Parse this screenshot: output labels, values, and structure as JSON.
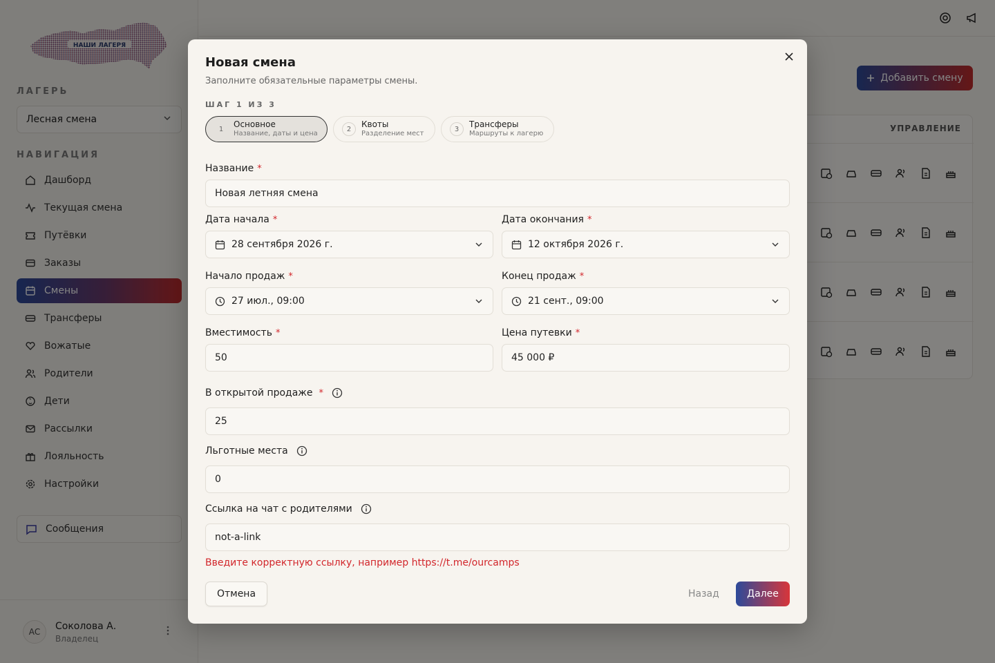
{
  "sidebar": {
    "logo_text": "НАШИ ЛАГЕРЯ",
    "camp_caption": "ЛАГЕРЬ",
    "camp_selected": "Лесная смена",
    "nav_caption": "НАВИГАЦИЯ",
    "items": [
      {
        "label": "Дашборд",
        "icon": "home-icon"
      },
      {
        "label": "Текущая смена",
        "icon": "activity-icon"
      },
      {
        "label": "Путёвки",
        "icon": "ticket-icon"
      },
      {
        "label": "Заказы",
        "icon": "card-icon"
      },
      {
        "label": "Смены",
        "icon": "calendar-icon",
        "active": true
      },
      {
        "label": "Трансферы",
        "icon": "bus-icon"
      },
      {
        "label": "Вожатые",
        "icon": "heart-hand-icon"
      },
      {
        "label": "Родители",
        "icon": "users-icon"
      },
      {
        "label": "Дети",
        "icon": "baby-icon"
      },
      {
        "label": "Рассылки",
        "icon": "mail-icon"
      },
      {
        "label": "Лояльность",
        "icon": "gift-icon"
      },
      {
        "label": "Настройки",
        "icon": "gear-icon"
      }
    ],
    "messages_label": "Сообщения",
    "user": {
      "initials": "АС",
      "name": "Соколова А.",
      "role": "Владелец"
    }
  },
  "main": {
    "add_button": "Добавить смену",
    "table_header": "УПРАВЛЕНИЕ"
  },
  "modal": {
    "title": "Новая смена",
    "subtitle": "Заполните обязательные параметры смены.",
    "step_indicator": "ШАГ 1 ИЗ 3",
    "steps": [
      {
        "num": "1",
        "title": "Основное",
        "desc": "Название, даты и цена"
      },
      {
        "num": "2",
        "title": "Квоты",
        "desc": "Разделение мест"
      },
      {
        "num": "3",
        "title": "Трансферы",
        "desc": "Маршруты к лагерю"
      }
    ],
    "fields": {
      "name": {
        "label": "Название",
        "value": "Новая летняя смена"
      },
      "start_date": {
        "label": "Дата начала",
        "value": "28 сентября 2026 г."
      },
      "end_date": {
        "label": "Дата окончания",
        "value": "12 октября 2026 г."
      },
      "sales_start": {
        "label": "Начало продаж",
        "value": "27 июл., 09:00"
      },
      "sales_end": {
        "label": "Конец продаж",
        "value": "21 сент., 09:00"
      },
      "capacity": {
        "label": "Вместимость",
        "value": "50"
      },
      "price": {
        "label": "Цена путевки",
        "value": "45 000 ₽"
      },
      "open_sale": {
        "label": "В открытой продаже",
        "value": "25"
      },
      "benefit": {
        "label": "Льготные места",
        "value": "0"
      },
      "chat_link": {
        "label": "Ссылка на чат с родителями",
        "value": "not-a-link"
      }
    },
    "required_mark": "*",
    "error_text": "Введите корректную ссылку, например https://t.me/ourcamps",
    "cancel_label": "Отмена",
    "back_label": "Назад",
    "next_label": "Далее"
  },
  "colors": {
    "accent_start": "#2d4a9a",
    "accent_end": "#d8363a",
    "error": "#d2262b"
  }
}
